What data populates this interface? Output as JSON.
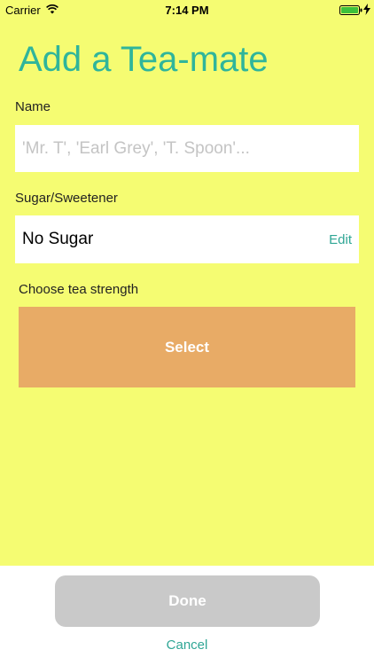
{
  "status_bar": {
    "carrier": "Carrier",
    "time": "7:14 PM",
    "wifi_icon": "wifi-icon",
    "battery_icon": "battery-icon",
    "charging_icon": "bolt-icon"
  },
  "header": {
    "title": "Add a Tea-mate"
  },
  "form": {
    "name_label": "Name",
    "name_value": "",
    "name_placeholder": "'Mr. T', 'Earl Grey', 'T. Spoon'...",
    "sugar_label": "Sugar/Sweetener",
    "sugar_value": "No Sugar",
    "sugar_edit_label": "Edit",
    "strength_label": "Choose tea strength",
    "strength_select_label": "Select"
  },
  "footer": {
    "done_label": "Done",
    "cancel_label": "Cancel"
  },
  "colors": {
    "background": "#f5fc72",
    "accent": "#2fb59b",
    "select_button": "#e8ab66",
    "done_button_disabled": "#c9c9c9"
  }
}
